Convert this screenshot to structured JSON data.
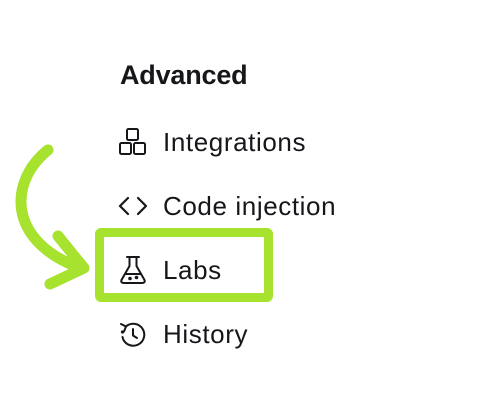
{
  "section": {
    "title": "Advanced"
  },
  "nav": {
    "items": [
      {
        "label": "Integrations",
        "icon": "integrations-icon"
      },
      {
        "label": "Code injection",
        "icon": "code-icon"
      },
      {
        "label": "Labs",
        "icon": "flask-icon",
        "highlighted": true
      },
      {
        "label": "History",
        "icon": "history-icon"
      }
    ]
  },
  "annotation": {
    "highlight_color": "#a6e22e",
    "arrow_color": "#a6e22e",
    "target": "Labs"
  }
}
